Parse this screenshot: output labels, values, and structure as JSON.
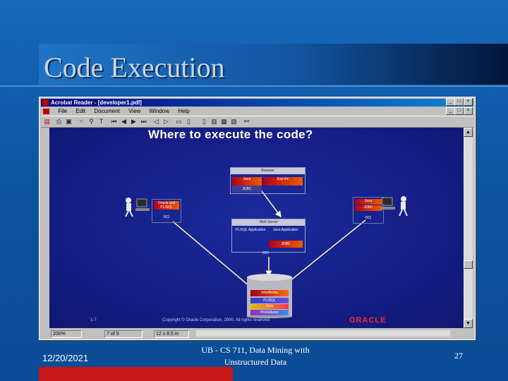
{
  "slide": {
    "title": "Code Execution",
    "footer_date": "12/20/2021",
    "footer_center": "UB - CS 711, Data Mining with Unstructured Data",
    "page_number": "27"
  },
  "window": {
    "title": "Acrobat Reader - [developer1.pdf]",
    "controls": [
      "_",
      "□",
      "×"
    ],
    "menu": [
      "File",
      "Edit",
      "Document",
      "View",
      "Window",
      "Help"
    ],
    "toolbar_icons": [
      "open-icon",
      "print-icon",
      "hand-icon",
      "zoom-icon",
      "select-text-icon",
      "first-page-icon",
      "prev-page-icon",
      "next-page-icon",
      "last-page-icon",
      "back-icon",
      "forward-icon",
      "page-only-icon",
      "bookmarks-icon",
      "thumbnails-icon",
      "find-icon"
    ],
    "status": {
      "zoom": "200%",
      "page": "7 of 9",
      "size": "12 x 8.5 in"
    }
  },
  "document_page": {
    "heading": "Where to execute the code?",
    "browser": {
      "label": "Browser",
      "items": [
        "Java",
        "Exp Inc",
        "JDBC"
      ]
    },
    "web_server": {
      "label": "Web Server",
      "items": [
        "PL/SQL Application",
        "Java Application",
        "JDBC"
      ],
      "oci_label": "OCI"
    },
    "left_client": {
      "items": [
        "Oracle and PL/SQL"
      ],
      "oci_label": "OCI"
    },
    "right_client": {
      "items": [
        "Java",
        "JDBC"
      ],
      "oci_label": "OCI"
    },
    "database": {
      "layers": [
        "interMedia",
        "PL/SQL",
        "Java",
        "Procedures"
      ]
    },
    "page_ref": "1-7",
    "copyright": "Copyright © Oracle Corporation, 2000. All rights reserved.",
    "logo_text": "ORACLE"
  },
  "colors": {
    "slide_bg": "#0c559f",
    "page_bg": "#141e86",
    "accent_red": "#c81616",
    "oracle_red": "#ff2a2a"
  }
}
